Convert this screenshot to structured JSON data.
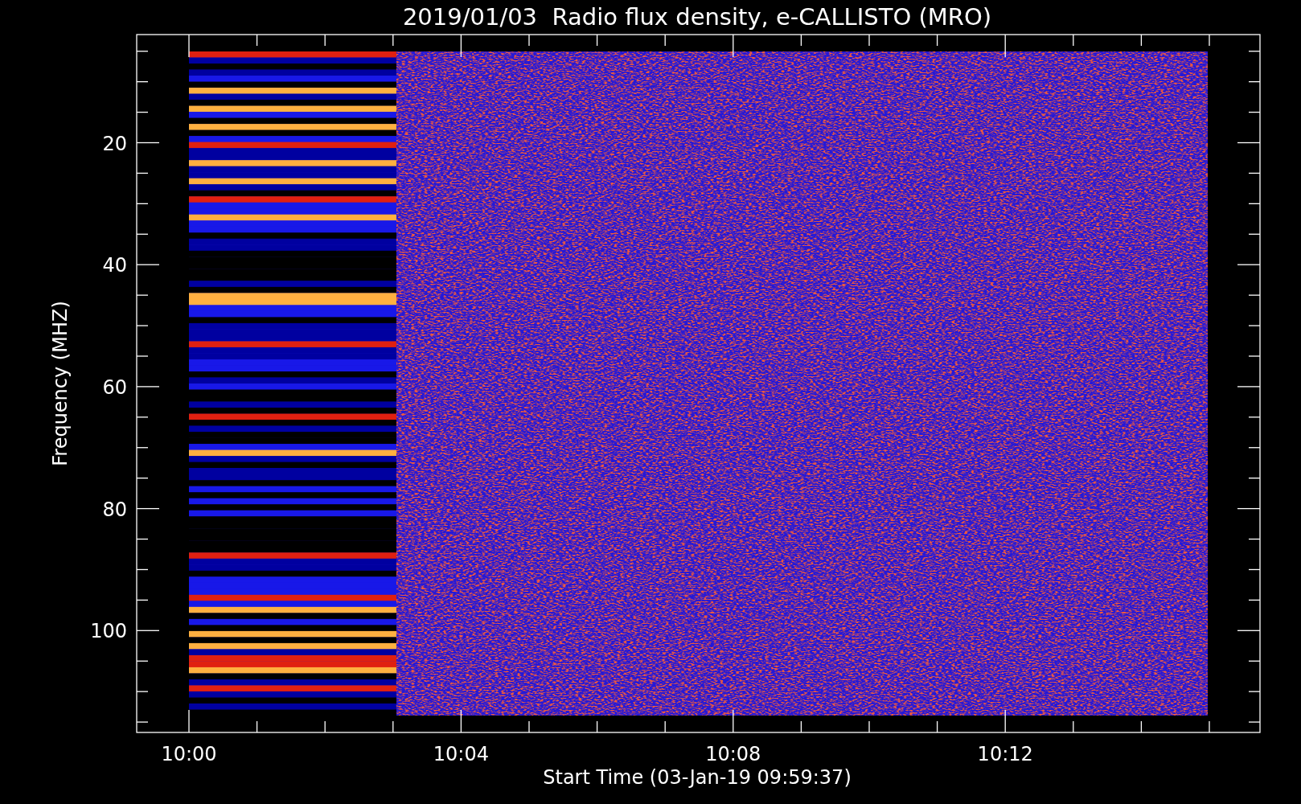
{
  "title": "2019/01/03  Radio flux density, e-CALLISTO (MRO)",
  "plot": {
    "xlabel": "Start Time (03-Jan-19 09:59:37)",
    "ylabel": "Frequency (MHZ)",
    "xticks": [
      "10:00",
      "10:04",
      "10:08",
      "10:12"
    ],
    "yticks": [
      "20",
      "40",
      "60",
      "80",
      "100"
    ]
  }
}
